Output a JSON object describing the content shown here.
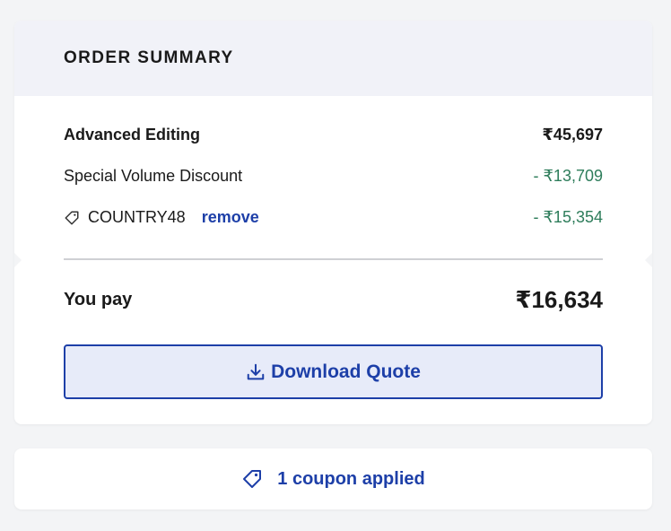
{
  "order_summary": {
    "title": "ORDER SUMMARY",
    "item": {
      "label": "Advanced Editing",
      "amount": "₹45,697"
    },
    "discount": {
      "label": "Special Volume Discount",
      "amount": "- ₹13,709"
    },
    "coupon": {
      "code": "COUNTRY48",
      "remove_label": "remove",
      "amount": "- ₹15,354",
      "icon": "tag-icon"
    },
    "total": {
      "label": "You pay",
      "amount": "₹16,634"
    },
    "download_button": {
      "label": "Download Quote",
      "icon": "download-icon"
    }
  },
  "coupon_status": {
    "label": "1 coupon applied",
    "icon": "tag-icon"
  },
  "colors": {
    "accent": "#1d3fa8",
    "discount_green": "#2e7d5b",
    "header_bg": "#f1f2f8",
    "button_bg": "#e7ebf9",
    "page_bg": "#f3f4f6"
  }
}
